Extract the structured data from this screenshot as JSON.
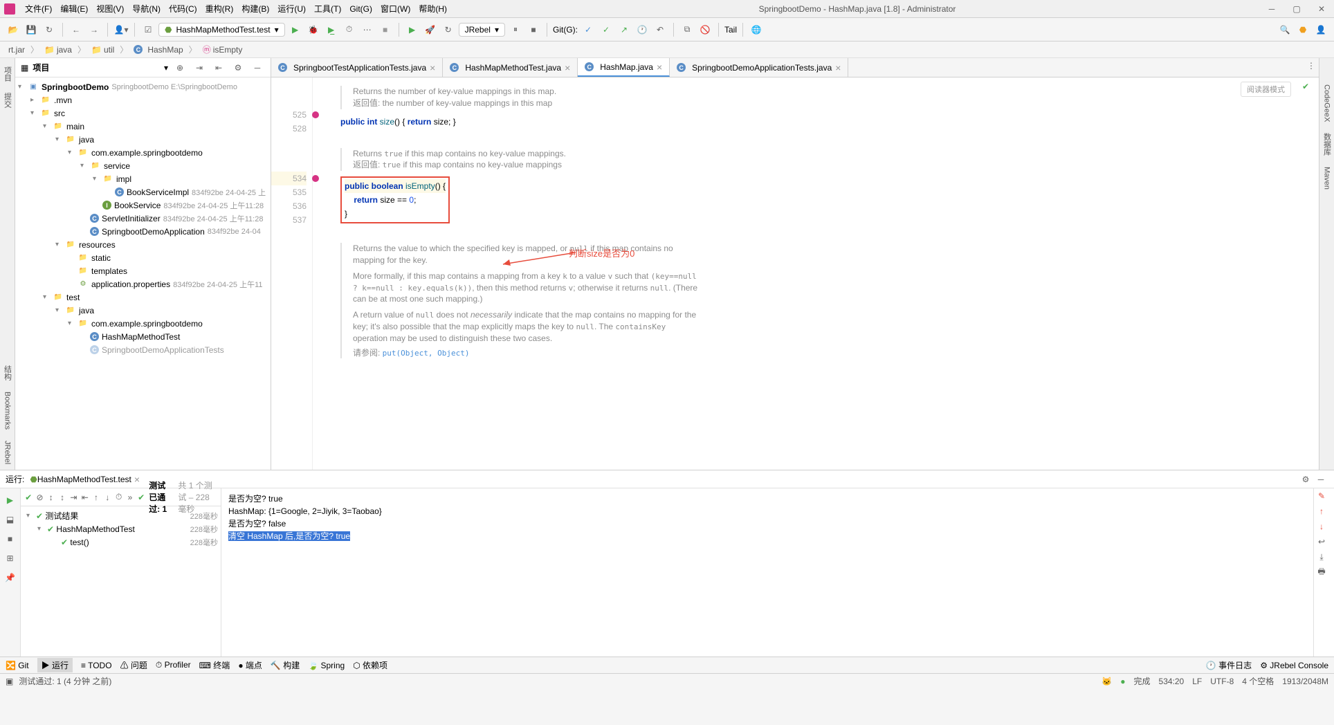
{
  "window": {
    "title": "SpringbootDemo - HashMap.java [1.8] - Administrator"
  },
  "menus": [
    "文件(F)",
    "编辑(E)",
    "视图(V)",
    "导航(N)",
    "代码(C)",
    "重构(R)",
    "构建(B)",
    "运行(U)",
    "工具(T)",
    "Git(G)",
    "窗口(W)",
    "帮助(H)"
  ],
  "runConfig": "HashMapMethodTest.test",
  "toolbarRight": {
    "jrebel": "JRebel",
    "gitLabel": "Git(G):",
    "tail": "Tail"
  },
  "breadcrumb": [
    "rt.jar",
    "java",
    "util",
    "HashMap",
    "isEmpty"
  ],
  "projectPanel": {
    "title": "项目"
  },
  "tree": {
    "root": {
      "name": "SpringbootDemo",
      "meta": "SpringbootDemo E:\\SpringbootDemo"
    },
    "mvn": ".mvn",
    "src": "src",
    "main": "main",
    "java": "java",
    "pkg": "com.example.springbootdemo",
    "service": "service",
    "impl": "impl",
    "bookServiceImpl": {
      "name": "BookServiceImpl",
      "meta": "834f92be 24-04-25 上"
    },
    "bookService": {
      "name": "BookService",
      "meta": "834f92be 24-04-25 上午11:28"
    },
    "servletInit": {
      "name": "ServletInitializer",
      "meta": "834f92be 24-04-25 上午11:28"
    },
    "demoApp": {
      "name": "SpringbootDemoApplication",
      "meta": "834f92be 24-04"
    },
    "resources": "resources",
    "static": "static",
    "templates": "templates",
    "appProps": {
      "name": "application.properties",
      "meta": "834f92be 24-04-25 上午11"
    },
    "test": "test",
    "testJava": "java",
    "testPkg": "com.example.springbootdemo",
    "hashMapTest": "HashMapMethodTest",
    "springbootTest": "SpringbootDemoApplicationTests"
  },
  "tabs": [
    "SpringbootTestApplicationTests.java",
    "HashMapMethodTest.java",
    "HashMap.java",
    "SpringbootDemoApplicationTests.java"
  ],
  "activeTab": 2,
  "readerMode": "阅读器模式",
  "gutter": [
    "525",
    "528",
    "",
    "",
    "534",
    "535",
    "536",
    "537"
  ],
  "code": {
    "doc1a": "Returns the number of key-value mappings in this map.",
    "doc1b": "返回值: the number of key-value mappings in this map",
    "line_size": "public int size() { return size; }",
    "doc2a": "Returns true if this map contains no key-value mappings.",
    "doc2b": "返回值: true if this map contains no key-value mappings",
    "line_isempty1": "public boolean isEmpty() {",
    "line_isempty2": "    return size == 0;",
    "line_isempty3": "}",
    "annotation": "判断size是否为0",
    "doc3a": "Returns the value to which the specified key is mapped, or null if this map contains no mapping for the key.",
    "doc3b": "More formally, if this map contains a mapping from a key k to a value v such that (key==null ? k==null : key.equals(k)), then this method returns v; otherwise it returns null. (There can be at most one such mapping.)",
    "doc3c": "A return value of null does not necessarily indicate that the map contains no mapping for the key; it's also possible that the map explicitly maps the key to null. The containsKey operation may be used to distinguish these two cases.",
    "doc3d": "请参阅: put(Object, Object)"
  },
  "runPanel": {
    "label": "运行:",
    "tabName": "HashMapMethodTest.test",
    "testStatus": "测试 已通过: 1",
    "testStatusSuffix": "共 1 个测试 – 228毫秒",
    "treeRoot": "测试结果",
    "treeRootTime": "228毫秒",
    "treeClass": "HashMapMethodTest",
    "treeClassTime": "228毫秒",
    "treeMethod": "test()",
    "treeMethodTime": "228毫秒",
    "console": {
      "l1": "是否为空? true",
      "l2": "HashMap: {1=Google, 2=Jiyik, 3=Taobao}",
      "l3": "是否为空? false",
      "l4": "清空 HashMap 后,是否为空?  true"
    }
  },
  "bottomBar": {
    "git": "Git",
    "run": "运行",
    "todo": "TODO",
    "problems": "问题",
    "profiler": "Profiler",
    "terminal": "终端",
    "breakpoints": "端点",
    "build": "构建",
    "spring": "Spring",
    "deps": "依赖项",
    "eventLog": "事件日志",
    "jrebelConsole": "JRebel Console"
  },
  "statusBar": {
    "msg": "测试通过: 1 (4 分钟 之前)",
    "done": "完成",
    "pos": "534:20",
    "lf": "LF",
    "enc": "UTF-8",
    "spaces": "4 个空格",
    "watermark": "1913/2048M"
  },
  "rightSidebar": [
    "CodeGeeX",
    "数据库",
    "Maven"
  ]
}
